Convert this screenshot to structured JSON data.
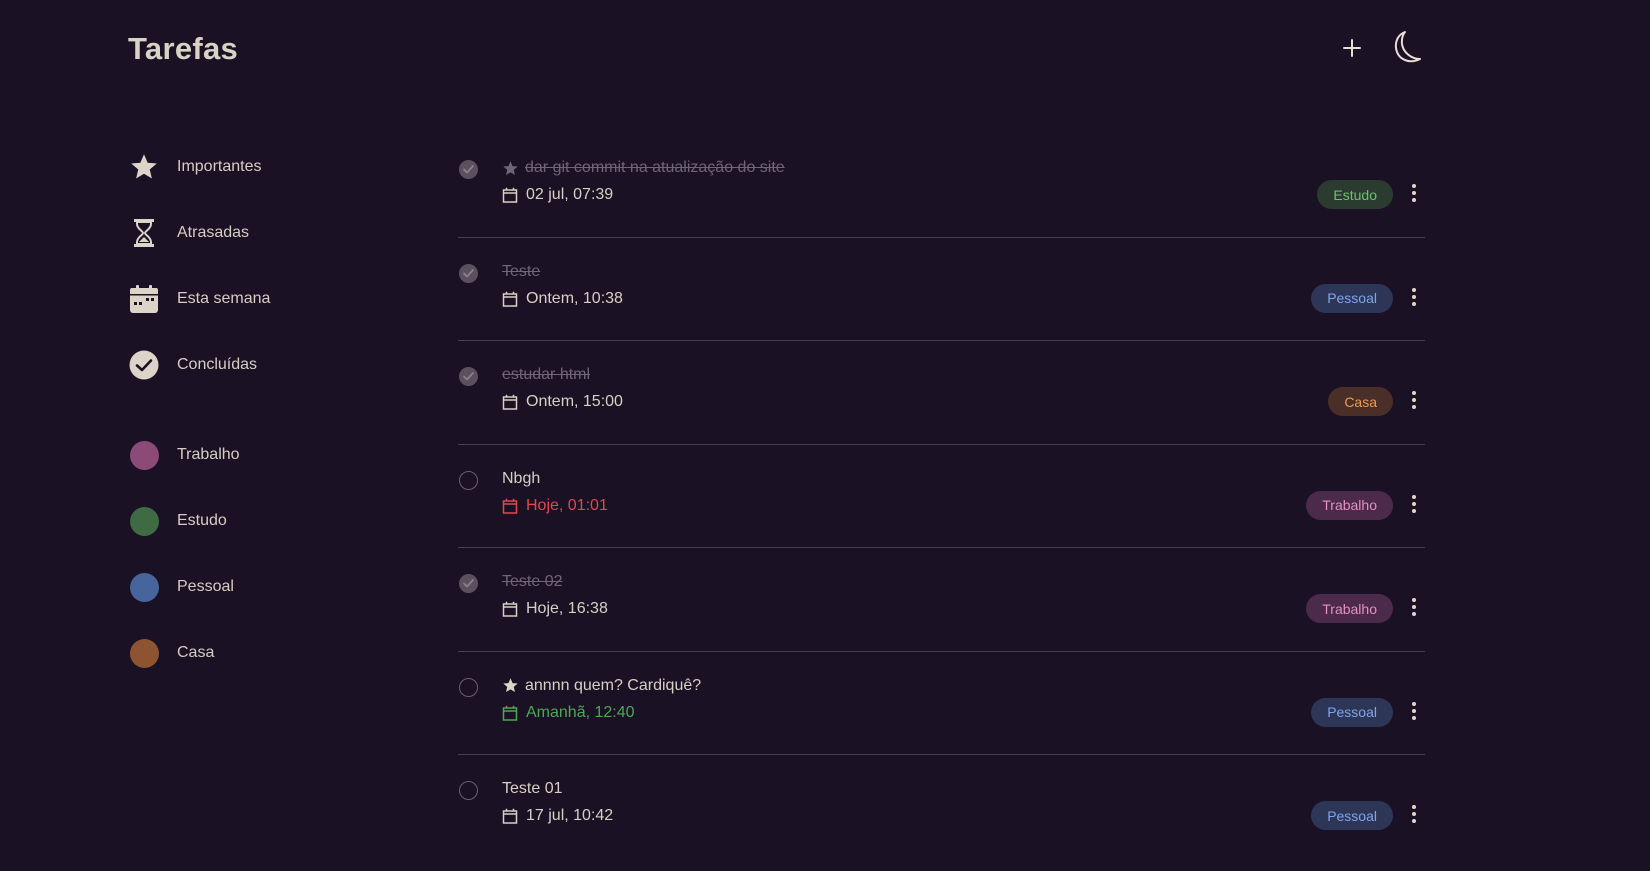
{
  "header": {
    "title": "Tarefas",
    "add_icon": "plus-icon",
    "theme_icon": "moon-icon"
  },
  "sidebar": {
    "filters": [
      {
        "label": "Importantes",
        "icon": "star-icon"
      },
      {
        "label": "Atrasadas",
        "icon": "hourglass-icon"
      },
      {
        "label": "Esta semana",
        "icon": "calendar-week-icon"
      },
      {
        "label": "Concluídas",
        "icon": "check-circle-icon"
      }
    ],
    "categories": [
      {
        "label": "Trabalho",
        "color": "#8c4a78"
      },
      {
        "label": "Estudo",
        "color": "#3f6b44"
      },
      {
        "label": "Pessoal",
        "color": "#47649d"
      },
      {
        "label": "Casa",
        "color": "#8e5330"
      }
    ]
  },
  "tasks": [
    {
      "title": "dar git commit na atualização do site",
      "date": "02 jul, 07:39",
      "tag": "Estudo",
      "done": true,
      "important": true,
      "date_color": "#d8d0c4"
    },
    {
      "title": "Teste",
      "date": "Ontem, 10:38",
      "tag": "Pessoal",
      "done": true,
      "important": false,
      "date_color": "#d8d0c4"
    },
    {
      "title": "estudar html",
      "date": "Ontem, 15:00",
      "tag": "Casa",
      "done": true,
      "important": false,
      "date_color": "#d8d0c4"
    },
    {
      "title": "Nbgh",
      "date": "Hoje, 01:01",
      "tag": "Trabalho",
      "done": false,
      "important": false,
      "date_color": "#e0484f"
    },
    {
      "title": "Teste 02",
      "date": "Hoje, 16:38",
      "tag": "Trabalho",
      "done": true,
      "important": false,
      "date_color": "#d8d0c4"
    },
    {
      "title": "annnn quem? Cardiquê?",
      "date": "Amanhã, 12:40",
      "tag": "Pessoal",
      "done": false,
      "important": true,
      "date_color": "#4fa656"
    },
    {
      "title": "Teste 01",
      "date": "17 jul, 10:42",
      "tag": "Pessoal",
      "done": false,
      "important": false,
      "date_color": "#d8d0c4"
    }
  ],
  "tag_styles": {
    "Estudo": {
      "bg": "#2b3b30",
      "fg": "#69c271"
    },
    "Pessoal": {
      "bg": "#2e3657",
      "fg": "#7ea6ec"
    },
    "Casa": {
      "bg": "#4a2e28",
      "fg": "#eb9a58"
    },
    "Trabalho": {
      "bg": "#4b2a4c",
      "fg": "#e58fc6"
    }
  }
}
